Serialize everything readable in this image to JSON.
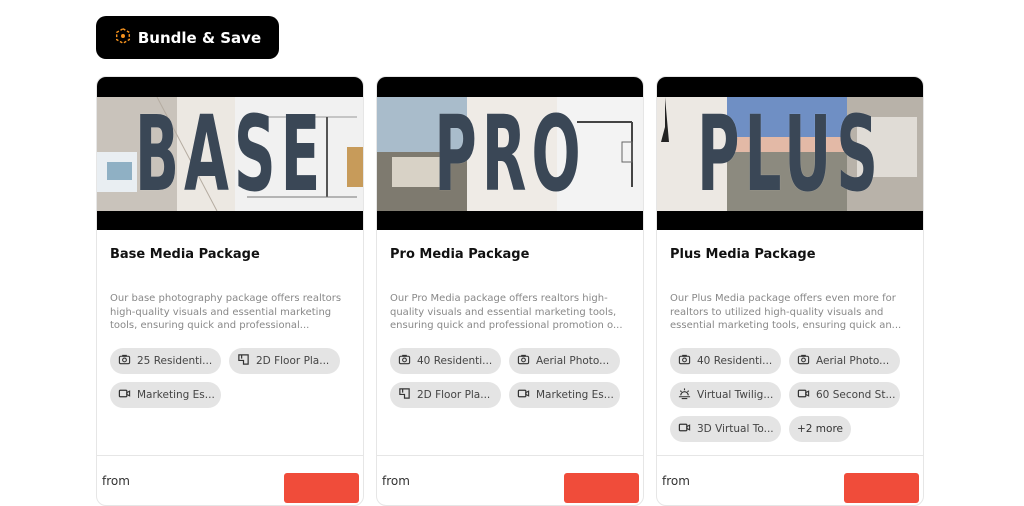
{
  "bundle_button": {
    "label": "Bundle & Save",
    "icon": "bundle-hex-icon",
    "accent": "#f7931e"
  },
  "cards": [
    {
      "hero_word": "BASE",
      "title": "Base Media Package",
      "description": "Our base photography package offers realtors high-quality visuals and essential marketing tools, ensuring quick and professional...",
      "chips": [
        {
          "icon": "camera-icon",
          "label": "25 Residenti..."
        },
        {
          "icon": "floor-plan-icon",
          "label": "2D Floor Pla..."
        },
        {
          "icon": "video-icon",
          "label": "Marketing Es..."
        }
      ],
      "from_label": "from"
    },
    {
      "hero_word": "PRO",
      "title": "Pro Media Package",
      "description": "Our Pro Media package offers realtors high-quality visuals and essential marketing tools, ensuring quick and professional promotion o...",
      "chips": [
        {
          "icon": "camera-icon",
          "label": "40 Residenti..."
        },
        {
          "icon": "camera-icon",
          "label": "Aerial Photo..."
        },
        {
          "icon": "floor-plan-icon",
          "label": "2D Floor Pla..."
        },
        {
          "icon": "video-icon",
          "label": "Marketing Es..."
        }
      ],
      "from_label": "from"
    },
    {
      "hero_word": "PLUS",
      "title": "Plus Media Package",
      "description": "Our Plus Media package offers even more for realtors to utilized high-quality visuals and essential marketing tools, ensuring quick an...",
      "chips": [
        {
          "icon": "camera-icon",
          "label": "40 Residenti..."
        },
        {
          "icon": "camera-icon",
          "label": "Aerial Photo..."
        },
        {
          "icon": "twilight-icon",
          "label": "Virtual Twilig..."
        },
        {
          "icon": "video-icon",
          "label": "60 Second St..."
        },
        {
          "icon": "video-icon",
          "label": "3D Virtual To..."
        }
      ],
      "more_chip": "+2 more",
      "from_label": "from"
    }
  ],
  "colors": {
    "cta": "#f04c3a",
    "chip_bg": "#e4e4e4",
    "hero_text": "#3a4756"
  }
}
